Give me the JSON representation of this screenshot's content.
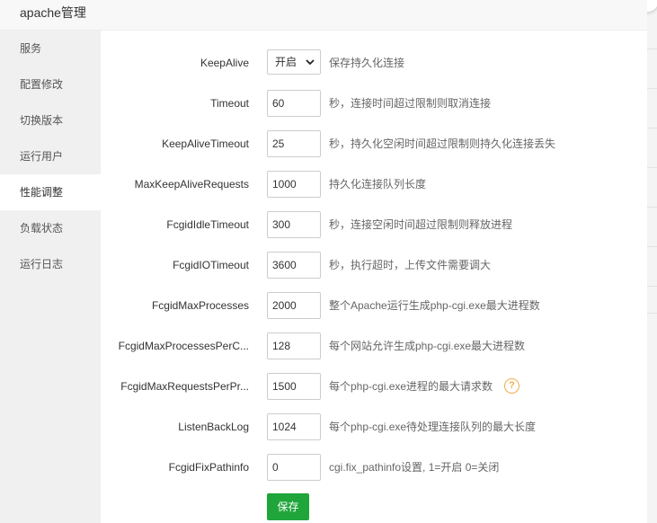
{
  "dialog": {
    "title": "apache管理"
  },
  "sidebar": {
    "items": [
      {
        "label": "服务"
      },
      {
        "label": "配置修改"
      },
      {
        "label": "切换版本"
      },
      {
        "label": "运行用户"
      },
      {
        "label": "性能调整",
        "active": true
      },
      {
        "label": "负载状态"
      },
      {
        "label": "运行日志"
      }
    ]
  },
  "form": {
    "keepalive": {
      "label": "KeepAlive",
      "value": "开启",
      "desc": "保存持久化连接"
    },
    "timeout": {
      "label": "Timeout",
      "value": "60",
      "desc": "秒，连接时间超过限制则取消连接"
    },
    "keepalive_timeout": {
      "label": "KeepAliveTimeout",
      "value": "25",
      "desc": "秒，持久化空闲时间超过限制则持久化连接丢失"
    },
    "max_keepalive_requests": {
      "label": "MaxKeepAliveRequests",
      "value": "1000",
      "desc": "持久化连接队列长度"
    },
    "fcgid_idle_timeout": {
      "label": "FcgidIdleTimeout",
      "value": "300",
      "desc": "秒，连接空闲时间超过限制则释放进程"
    },
    "fcgid_io_timeout": {
      "label": "FcgidIOTimeout",
      "value": "3600",
      "desc": "秒，执行超时，上传文件需要调大"
    },
    "fcgid_max_processes": {
      "label": "FcgidMaxProcesses",
      "value": "2000",
      "desc": "整个Apache运行生成php-cgi.exe最大进程数"
    },
    "fcgid_max_processes_per_class": {
      "label": "FcgidMaxProcessesPerC...",
      "value": "128",
      "desc": "每个网站允许生成php-cgi.exe最大进程数"
    },
    "fcgid_max_requests_per_process": {
      "label": "FcgidMaxRequestsPerPr...",
      "value": "1500",
      "desc": "每个php-cgi.exe进程的最大请求数"
    },
    "listen_backlog": {
      "label": "ListenBackLog",
      "value": "1024",
      "desc": "每个php-cgi.exe待处理连接队列的最大长度"
    },
    "fcgid_fix_pathinfo": {
      "label": "FcgidFixPathinfo",
      "value": "0",
      "desc": "cgi.fix_pathinfo设置, 1=开启 0=关闭"
    }
  },
  "buttons": {
    "save_label": "保存"
  },
  "icons": {
    "help": "question-circle-icon",
    "select_arrow": "chevron-down-icon"
  },
  "colors": {
    "accent": "#20a53a",
    "help": "#f0ad4e"
  }
}
